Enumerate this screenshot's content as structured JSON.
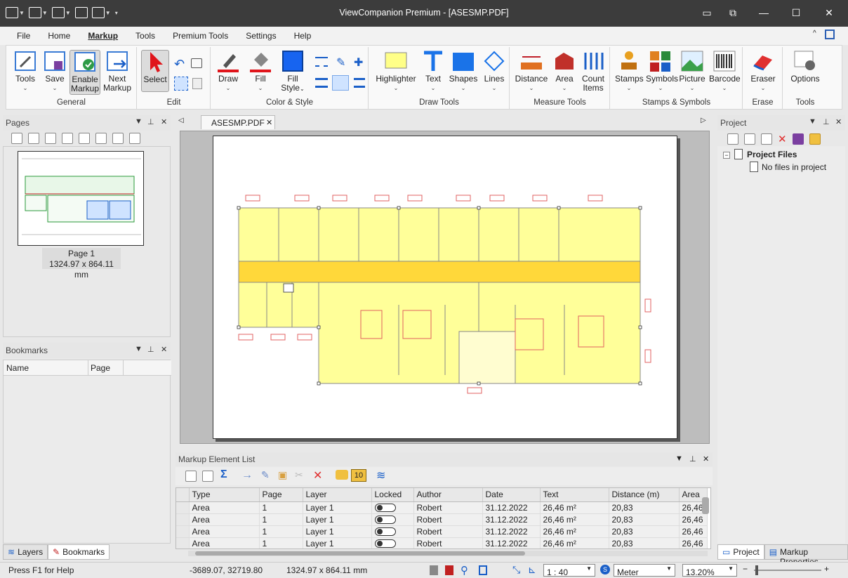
{
  "window": {
    "title": "ViewCompanion Premium - [ASESMP.PDF]"
  },
  "menu": [
    "File",
    "Home",
    "Markup",
    "Tools",
    "Premium Tools",
    "Settings",
    "Help"
  ],
  "menu_active": "Markup",
  "ribbon": {
    "groups": {
      "general": "General",
      "edit": "Edit",
      "color_style": "Color & Style",
      "draw_tools": "Draw Tools",
      "measure_tools": "Measure Tools",
      "stamps_symbols": "Stamps & Symbols",
      "erase": "Erase",
      "tools": "Tools"
    },
    "buttons": {
      "tools": "Tools",
      "save": "Save",
      "enable_markup_1": "Enable",
      "enable_markup_2": "Markup",
      "next_markup_1": "Next",
      "next_markup_2": "Markup",
      "select": "Select",
      "draw": "Draw",
      "fill": "Fill",
      "fill_style_1": "Fill",
      "fill_style_2": "Style",
      "highlighter": "Highlighter",
      "text": "Text",
      "shapes": "Shapes",
      "lines": "Lines",
      "distance": "Distance",
      "area": "Area",
      "count_items_1": "Count",
      "count_items_2": "Items",
      "stamps": "Stamps",
      "symbols": "Symbols",
      "picture": "Picture",
      "barcode": "Barcode",
      "eraser": "Eraser",
      "options": "Options"
    },
    "colors": {
      "draw_line": "#e0151b",
      "fill_color": "#1764f0",
      "highlighter": "#ffff88",
      "shapes": "#1a73e8"
    }
  },
  "pages_panel": {
    "title": "Pages",
    "page_name": "Page 1",
    "page_size": "1324.97 x 864.11 mm"
  },
  "bookmarks_panel": {
    "title": "Bookmarks",
    "columns": [
      "Name",
      "Page"
    ]
  },
  "bottom_tabs": [
    "Layers",
    "Bookmarks"
  ],
  "doc_tab": "ASESMP.PDF",
  "project_panel": {
    "title": "Project",
    "root": "Project Files",
    "empty": "No files in project"
  },
  "project_tabs": [
    "Project",
    "Markup Properties"
  ],
  "markup_list": {
    "title": "Markup Element List",
    "badge": "10",
    "columns": [
      "Type",
      "Page",
      "Layer",
      "Locked",
      "Author",
      "Date",
      "Text",
      "Distance (m)",
      "Area"
    ],
    "rows": [
      [
        "Area",
        "1",
        "Layer 1",
        "",
        "Robert",
        "31.12.2022",
        "26,46 m²",
        "20,83",
        "26,46"
      ],
      [
        "Area",
        "1",
        "Layer 1",
        "",
        "Robert",
        "31.12.2022",
        "26,46 m²",
        "20,83",
        "26,46"
      ],
      [
        "Area",
        "1",
        "Layer 1",
        "",
        "Robert",
        "31.12.2022",
        "26,46 m²",
        "20,83",
        "26,46"
      ],
      [
        "Area",
        "1",
        "Layer 1",
        "",
        "Robert",
        "31.12.2022",
        "26,46 m²",
        "20,83",
        "26,46"
      ]
    ]
  },
  "status": {
    "help": "Press F1 for Help",
    "coords": "-3689.07, 32719.80",
    "size": "1324.97 x 864.11 mm",
    "scale": "1 : 40",
    "unit": "Meter",
    "zoom": "13.20%"
  }
}
